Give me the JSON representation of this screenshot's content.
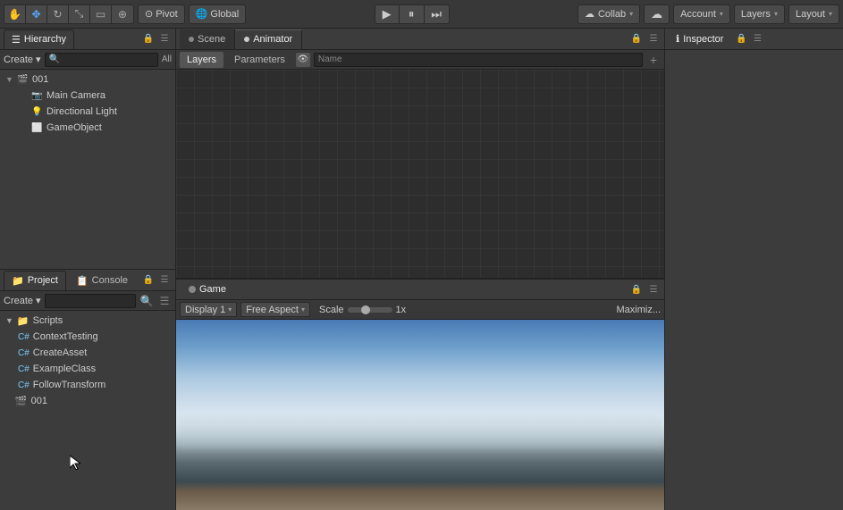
{
  "toolbar": {
    "pivot_label": "Pivot",
    "global_label": "Global",
    "collab_label": "Collab",
    "account_label": "Account",
    "layers_label": "Layers",
    "layout_label": "Layout",
    "account_dropdown_arrow": "▾",
    "layers_dropdown_arrow": "▾",
    "layout_dropdown_arrow": "▾",
    "collab_dropdown_arrow": "▾"
  },
  "hierarchy": {
    "tab_label": "Hierarchy",
    "create_label": "Create",
    "all_label": "All",
    "search_placeholder": "",
    "items": [
      {
        "id": "001",
        "label": "001",
        "type": "scene",
        "indent": 0,
        "expanded": true
      },
      {
        "id": "main-camera",
        "label": "Main Camera",
        "type": "camera",
        "indent": 1
      },
      {
        "id": "directional-light",
        "label": "Directional Light",
        "type": "light",
        "indent": 1
      },
      {
        "id": "gameobject",
        "label": "GameObject",
        "type": "object",
        "indent": 1
      }
    ]
  },
  "scene": {
    "tab_label": "Scene",
    "animator_tab_label": "Animator",
    "layers_tab_label": "Layers",
    "parameters_tab_label": "Parameters",
    "name_column": "Name",
    "add_btn": "+"
  },
  "game": {
    "tab_label": "Game",
    "display_label": "Display 1",
    "aspect_label": "Free Aspect",
    "scale_label": "Scale",
    "scale_value": "1x",
    "maximize_label": "Maximiz..."
  },
  "inspector": {
    "tab_label": "Inspector",
    "lock_icon": "🔒"
  },
  "project": {
    "tab_label": "Project",
    "console_tab_label": "Console",
    "create_label": "Create",
    "search_placeholder": "",
    "folders": [
      {
        "id": "scripts",
        "label": "Scripts",
        "type": "folder",
        "indent": 0,
        "expanded": true
      },
      {
        "id": "contexttesting",
        "label": "ContextTesting",
        "type": "script",
        "indent": 1
      },
      {
        "id": "createasset",
        "label": "CreateAsset",
        "type": "script",
        "indent": 1
      },
      {
        "id": "exampleclass",
        "label": "ExampleClass",
        "type": "script",
        "indent": 1
      },
      {
        "id": "followtransform",
        "label": "FollowTransform",
        "type": "script",
        "indent": 1
      }
    ],
    "assets": [
      {
        "id": "001-asset",
        "label": "001",
        "type": "scene",
        "indent": 0
      }
    ]
  },
  "icons": {
    "expand_arrow": "▶",
    "collapse_arrow": "▼",
    "search": "🔍",
    "add": "+",
    "lock": "🔒",
    "eye": "👁",
    "scene_icon": "⬡",
    "camera_icon": "📷",
    "light_icon": "💡",
    "object_icon": "⬜",
    "folder": "📁",
    "script": "📄",
    "asset_icon": "🎬",
    "drag_h": "⠿",
    "settings": "⚙",
    "menu": "☰",
    "collab": "☁",
    "pivot": "⊙",
    "global": "🌐",
    "center": "⊕",
    "rect": "▭",
    "scale": "⤡",
    "rotate": "↻",
    "translate": "✥",
    "hand": "✋",
    "undo": "↩",
    "redo": "↪",
    "play": "▶",
    "pause": "⏸",
    "step": "⏭"
  }
}
